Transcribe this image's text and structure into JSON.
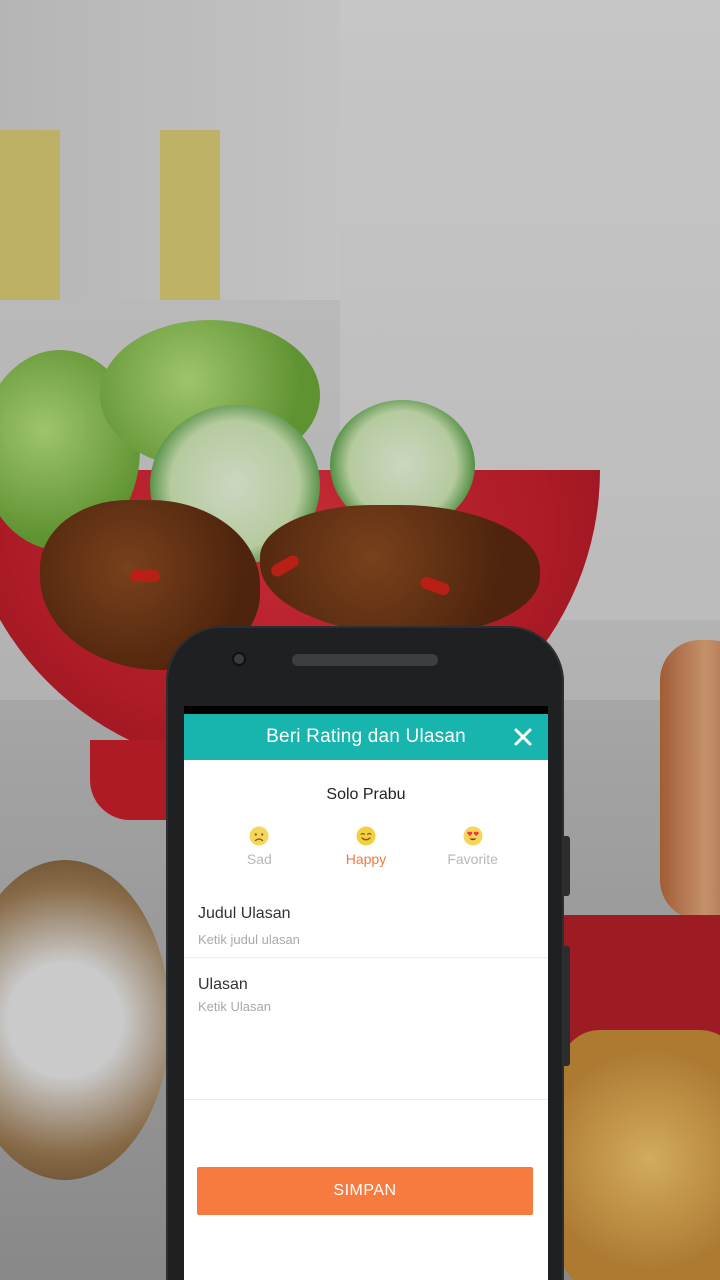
{
  "dialog": {
    "title": "Beri Rating dan Ulasan",
    "close_icon": "close-icon",
    "header_color": "#17b5ad"
  },
  "restaurant": {
    "name": "Solo Prabu"
  },
  "moods": [
    {
      "label": "Sad",
      "icon": "sad-face-icon",
      "selected": false
    },
    {
      "label": "Happy",
      "icon": "happy-face-icon",
      "selected": true
    },
    {
      "label": "Favorite",
      "icon": "heart-eyes-face-icon",
      "selected": false
    }
  ],
  "review_title": {
    "label": "Judul Ulasan",
    "value": "",
    "placeholder": "Ketik judul ulasan"
  },
  "review_body": {
    "label": "Ulasan",
    "value": "",
    "placeholder": "Ketik Ulasan"
  },
  "save": {
    "label": "SIMPAN",
    "color": "#f77a3f"
  },
  "colors": {
    "selected_mood": "#f07a3b",
    "unselected_mood": "#b8b8b8"
  }
}
